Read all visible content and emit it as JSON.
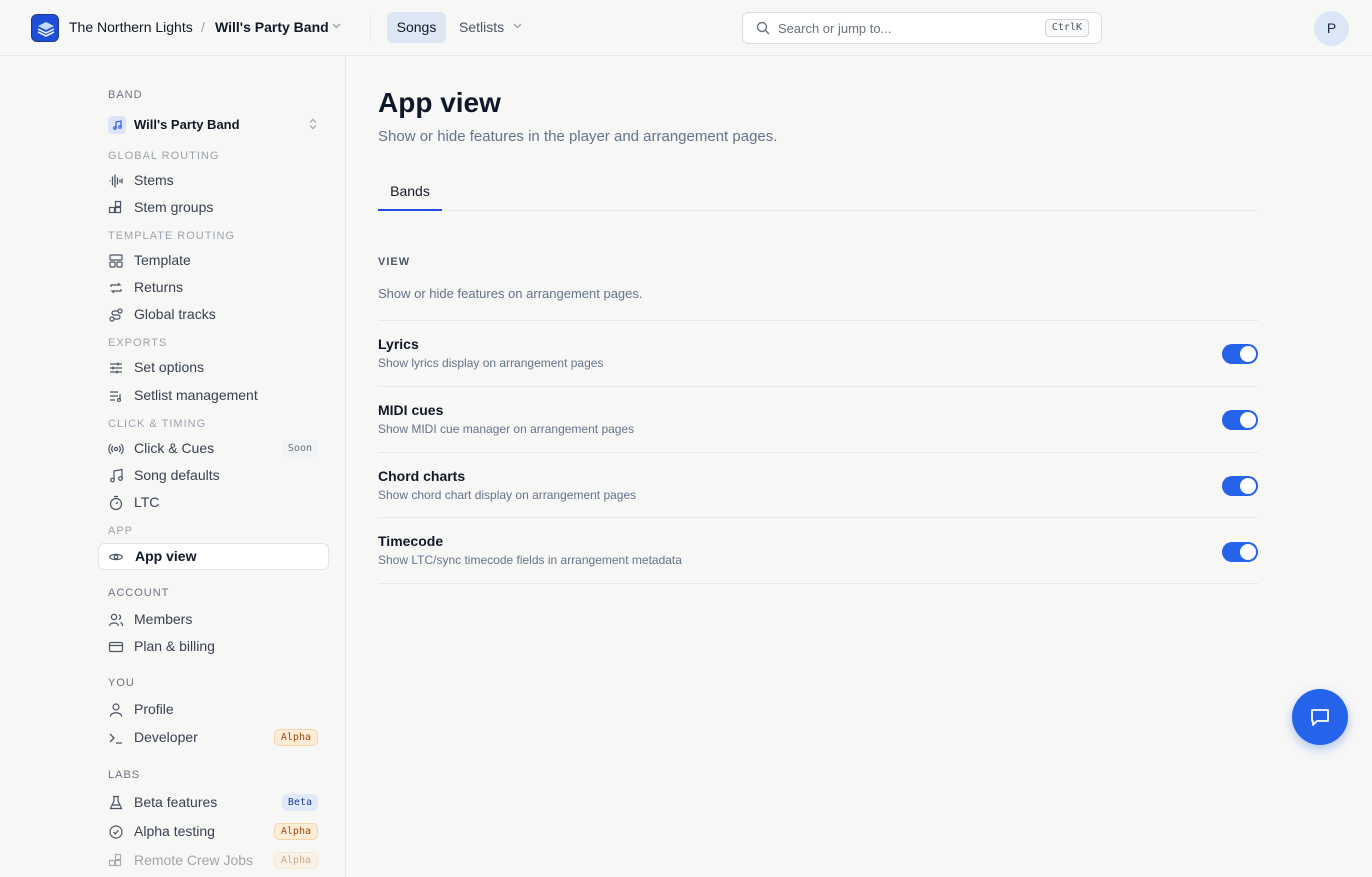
{
  "topbar": {
    "org_name": "The Northern Lights",
    "separator": "/",
    "band_name": "Will's Party Band",
    "nav_songs": "Songs",
    "nav_setlists": "Setlists",
    "search_placeholder": "Search or jump to...",
    "search_shortcut": "CtrlK",
    "avatar_initial": "P"
  },
  "sidebar": {
    "band_section": "BAND",
    "band_selected": "Will's Party Band",
    "global_routing": "GLOBAL ROUTING",
    "stems": "Stems",
    "stem_groups": "Stem groups",
    "template_routing": "TEMPLATE ROUTING",
    "template": "Template",
    "returns": "Returns",
    "global_tracks": "Global tracks",
    "exports": "EXPORTS",
    "set_options": "Set options",
    "setlist_management": "Setlist management",
    "click_timing": "CLICK & TIMING",
    "click_cues": "Click & Cues",
    "click_cues_badge": "Soon",
    "song_defaults": "Song defaults",
    "ltc": "LTC",
    "app": "APP",
    "app_view": "App view",
    "account": "ACCOUNT",
    "members": "Members",
    "plan_billing": "Plan & billing",
    "you": "YOU",
    "profile": "Profile",
    "developer": "Developer",
    "developer_badge": "Alpha",
    "labs": "LABS",
    "beta_features": "Beta features",
    "beta_features_badge": "Beta",
    "alpha_testing": "Alpha testing",
    "alpha_testing_badge": "Alpha",
    "remote_crew_jobs": "Remote Crew Jobs",
    "remote_crew_jobs_badge": "Alpha"
  },
  "main": {
    "title": "App view",
    "subtitle": "Show or hide features in the player and arrangement pages.",
    "tab_bands": "Bands",
    "view_label": "VIEW",
    "view_desc": "Show or hide features on arrangement pages.",
    "rows": [
      {
        "title": "Lyrics",
        "desc": "Show lyrics display on arrangement pages",
        "enabled": true
      },
      {
        "title": "MIDI cues",
        "desc": "Show MIDI cue manager on arrangement pages",
        "enabled": true
      },
      {
        "title": "Chord charts",
        "desc": "Show chord chart display on arrangement pages",
        "enabled": true
      },
      {
        "title": "Timecode",
        "desc": "Show LTC/sync timecode fields in arrangement metadata",
        "enabled": true
      }
    ]
  },
  "colors": {
    "accent": "#2563eb",
    "background": "#f7f7f6"
  }
}
